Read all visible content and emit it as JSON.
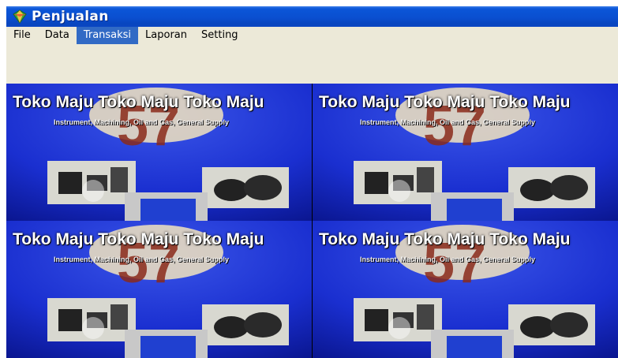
{
  "window": {
    "title": "Penjualan",
    "icon": "gem-icon"
  },
  "menu": {
    "items": [
      {
        "label": "File",
        "active": false
      },
      {
        "label": "Data",
        "active": false
      },
      {
        "label": "Transaksi",
        "active": true
      },
      {
        "label": "Laporan",
        "active": false
      },
      {
        "label": "Setting",
        "active": false
      }
    ]
  },
  "banner": {
    "heading": "Toko Maju Toko Maju Toko Maju",
    "tagline": "Instrument, Machining, Oil and Gas, General Supply",
    "big_number": "57"
  },
  "colors": {
    "title_bar": "#0a4fd0",
    "menu_bg": "#ece9d8",
    "menu_highlight": "#316ac5",
    "banner_bg": "#1a2fd0"
  }
}
